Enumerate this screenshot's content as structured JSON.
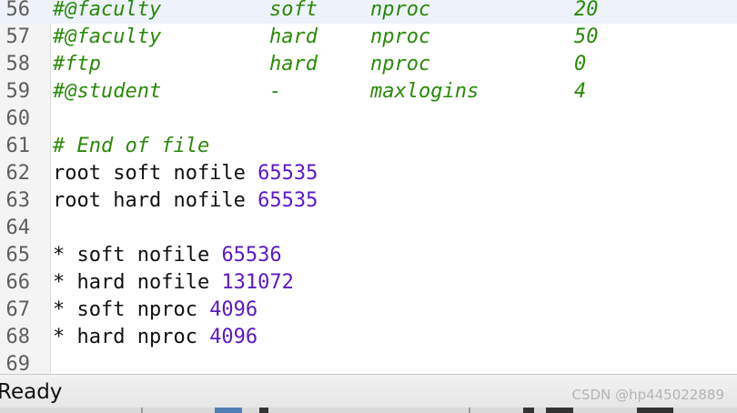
{
  "editor": {
    "lines": [
      {
        "num": "56",
        "c1": "#@faculty",
        "c2": "soft",
        "c3": "nproc",
        "c4": "20",
        "highlighted": true
      },
      {
        "num": "57",
        "c1": "#@faculty",
        "c2": "hard",
        "c3": "nproc",
        "c4": "50"
      },
      {
        "num": "58",
        "c1": "#ftp",
        "c2": "hard",
        "c3": "nproc",
        "c4": "0"
      },
      {
        "num": "59",
        "c1": "#@student",
        "c2": "-",
        "c3": "maxlogins",
        "c4": "4"
      },
      {
        "num": "60"
      },
      {
        "num": "61",
        "comment": "# End of file"
      },
      {
        "num": "62",
        "text": "root soft nofile ",
        "value": "65535"
      },
      {
        "num": "63",
        "text": "root hard nofile ",
        "value": "65535"
      },
      {
        "num": "64"
      },
      {
        "num": "65",
        "text": "* soft nofile ",
        "value": "65536"
      },
      {
        "num": "66",
        "text": "* hard nofile ",
        "value": "131072"
      },
      {
        "num": "67",
        "text": "* soft nproc ",
        "value": "4096"
      },
      {
        "num": "68",
        "text": "* hard nproc ",
        "value": "4096"
      },
      {
        "num": "69"
      }
    ]
  },
  "status": {
    "text": "Ready",
    "watermark": "CSDN @hp445022889"
  },
  "colors": {
    "comment": "#2a8a0a",
    "number": "#5b18c4",
    "text": "#111111",
    "line_number": "#5e5e5e",
    "current_line": "#eef2fb"
  }
}
